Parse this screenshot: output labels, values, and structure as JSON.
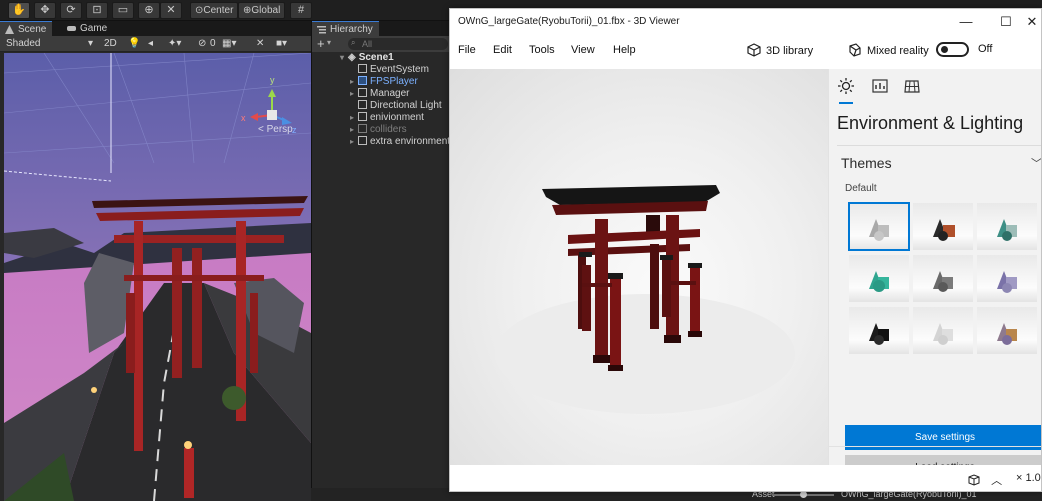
{
  "unity": {
    "toolbar": {
      "pivot_label": "Center",
      "space_label": "Global"
    },
    "scene_tabs": [
      {
        "label": "Scene"
      },
      {
        "label": "Game"
      }
    ],
    "scene_controls": {
      "draw_mode": "Shaded",
      "dim_toggle": "2D",
      "layers_count": "0"
    },
    "persp_label": "< Persp",
    "axis_labels": {
      "y": "y",
      "x": "x",
      "z": "z"
    },
    "hierarchy": {
      "tab_label": "Hierarchy",
      "add_label": "+",
      "search_placeholder": "All",
      "scene_name": "Scene1",
      "items": [
        {
          "label": "EventSystem"
        },
        {
          "label": "FPSPlayer"
        },
        {
          "label": "Manager"
        },
        {
          "label": "Directional Light"
        },
        {
          "label": "enivionment"
        },
        {
          "label": "colliders"
        },
        {
          "label": "extra environment"
        }
      ]
    },
    "bottom": {
      "asset_label": "Asset",
      "asset_path": "OWnG_largeGate(RyobuTorii)_01",
      "slider_fraction": 0.5
    }
  },
  "viewer": {
    "title": "OWnG_largeGate(RyobuTorii)_01.fbx - 3D Viewer",
    "window_controls": {
      "minimize": "—",
      "maximize": "☐",
      "close": "✕"
    },
    "menu": [
      {
        "label": "File"
      },
      {
        "label": "Edit"
      },
      {
        "label": "Tools"
      },
      {
        "label": "View"
      },
      {
        "label": "Help"
      }
    ],
    "library_label": "3D library",
    "mixed_reality_label": "Mixed reality",
    "mixed_reality_state": "Off",
    "side_panel": {
      "heading": "Environment & Lighting",
      "themes_label": "Themes",
      "default_label": "Default",
      "save_label": "Save settings",
      "load_label": "Load settings"
    },
    "zoom": "× 1.0",
    "colors": {
      "accent": "#0078d4",
      "torii": "#7a1414",
      "torii_top": "#151515"
    },
    "icons": {
      "lighting": "sun-icon",
      "stats": "stats-icon",
      "grid": "grid-icon",
      "library": "cube-icon",
      "mixed_reality": "mixed-reality-icon",
      "themes": "chevron-down-icon"
    }
  }
}
